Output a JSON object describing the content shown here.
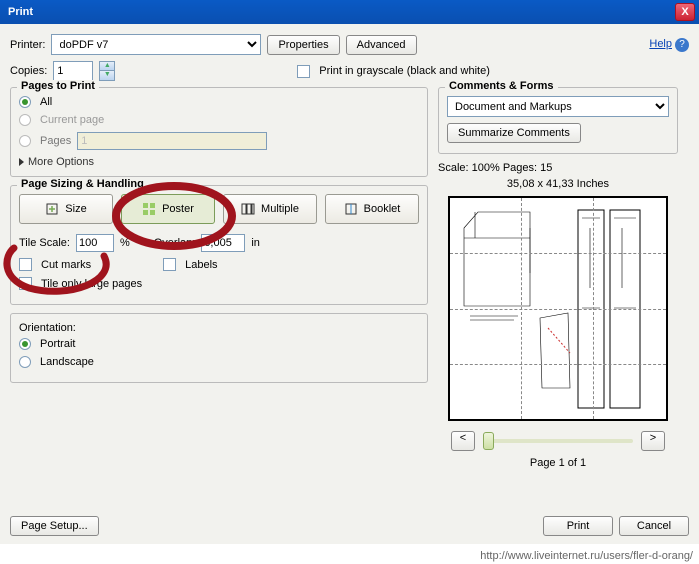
{
  "title": "Print",
  "close": "X",
  "help": "Help",
  "printerLabel": "Printer:",
  "printerSel": "doPDF v7",
  "properties": "Properties",
  "advanced": "Advanced",
  "copiesLabel": "Copies:",
  "copiesVal": "1",
  "grayscale": "Print in grayscale (black and white)",
  "pagesToPrint": {
    "legend": "Pages to Print",
    "all": "All",
    "current": "Current page",
    "pages": "Pages",
    "pagesVal": "1",
    "more": "More Options"
  },
  "sizing": {
    "legend": "Page Sizing & Handling",
    "size": "Size",
    "poster": "Poster",
    "multiple": "Multiple",
    "booklet": "Booklet",
    "tileScaleLabel": "Tile Scale:",
    "tileScaleVal": "100",
    "pct": "%",
    "overlapLabel": "Overlap:",
    "overlapVal": "0,005",
    "unit": "in",
    "cutmarks": "Cut marks",
    "labels": "Labels",
    "tileOnly": "Tile only large pages"
  },
  "orient": {
    "legend": "Orientation:",
    "portrait": "Portrait",
    "landscape": "Landscape"
  },
  "comments": {
    "legend": "Comments & Forms",
    "sel": "Document and Markups",
    "summarize": "Summarize Comments"
  },
  "scaleInfo": "Scale: 100% Pages: 15",
  "dim": "35,08 x 41,33 Inches",
  "navPrev": "<",
  "navNext": ">",
  "pageOf": "Page 1 of 1",
  "pageSetup": "Page Setup...",
  "print": "Print",
  "cancel": "Cancel",
  "url": "http://www.liveinternet.ru/users/fler-d-orang/"
}
